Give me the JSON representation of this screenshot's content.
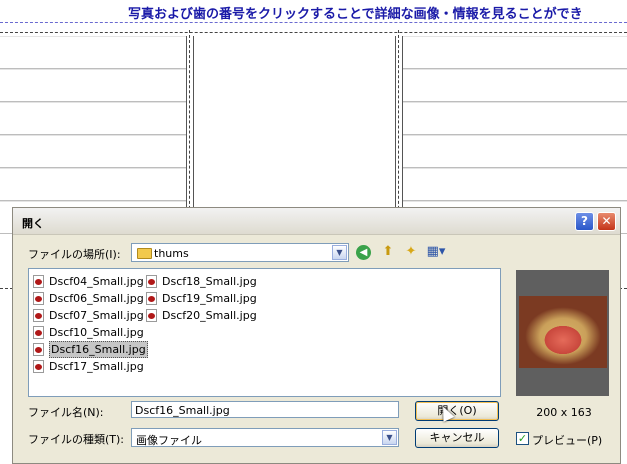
{
  "page": {
    "header_text": "写真および歯の番号をクリックすることで詳細な画像・情報を見ることができ"
  },
  "dialog": {
    "title": "開く",
    "help_glyph": "?",
    "close_glyph": "✕",
    "location_label": "ファイルの場所(I):",
    "location_value": "thums",
    "toolbar": {
      "back_icon": "back-icon",
      "up_icon": "up-folder-icon",
      "new_folder_icon": "new-folder-icon",
      "view_menu_icon": "view-menu-icon"
    },
    "files": [
      {
        "name": "Dscf04_Small.jpg",
        "selected": false
      },
      {
        "name": "Dscf06_Small.jpg",
        "selected": false
      },
      {
        "name": "Dscf07_Small.jpg",
        "selected": false
      },
      {
        "name": "Dscf10_Small.jpg",
        "selected": false
      },
      {
        "name": "Dscf16_Small.jpg",
        "selected": true
      },
      {
        "name": "Dscf17_Small.jpg",
        "selected": false
      },
      {
        "name": "Dscf18_Small.jpg",
        "selected": false
      },
      {
        "name": "Dscf19_Small.jpg",
        "selected": false
      },
      {
        "name": "Dscf20_Small.jpg",
        "selected": false
      }
    ],
    "preview": {
      "dimensions": "200 x 163"
    },
    "filename_label": "ファイル名(N):",
    "filename_value": "Dscf16_Small.jpg",
    "filetype_label": "ファイルの種類(T):",
    "filetype_value": "画像ファイル",
    "open_button": "開く(O)",
    "cancel_button": "キャンセル",
    "preview_checkbox_label": "プレビュー(P)",
    "preview_checked": true,
    "check_glyph": "✓",
    "dropdown_arrow": "▼"
  }
}
